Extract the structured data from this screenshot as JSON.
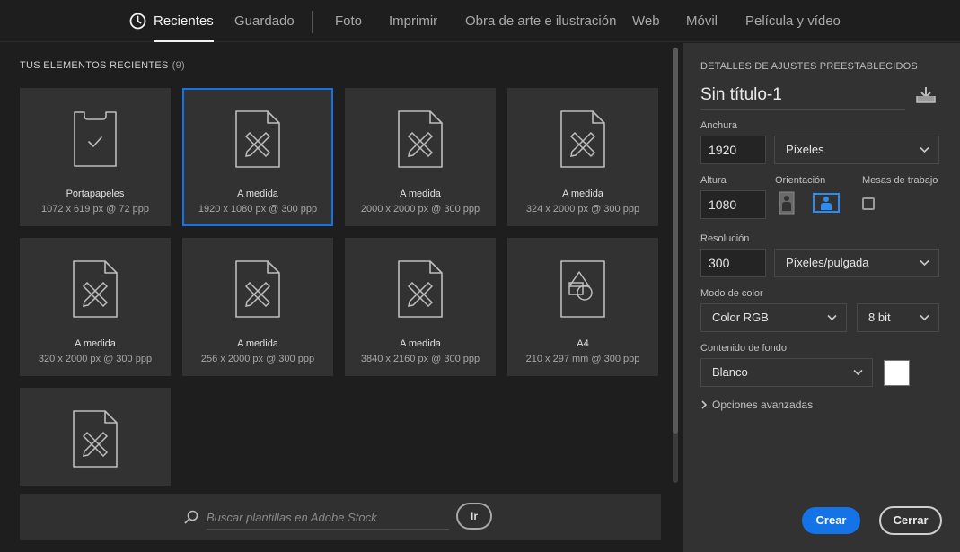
{
  "tabs": [
    {
      "label": "Recientes",
      "active": true,
      "icon": "clock-icon"
    },
    {
      "label": "Guardado"
    },
    {
      "label": "Foto"
    },
    {
      "label": "Imprimir"
    },
    {
      "label": "Obra de arte e ilustración"
    },
    {
      "label": "Web"
    },
    {
      "label": "Móvil"
    },
    {
      "label": "Película y vídeo"
    }
  ],
  "recent": {
    "title": "TUS ELEMENTOS RECIENTES",
    "count": "(9)",
    "items": [
      {
        "name": "Portapapeles",
        "dims": "1072 x 619 px @ 72 ppp",
        "icon": "clipboard-icon"
      },
      {
        "name": "A medida",
        "dims": "1920 x 1080 px @ 300 ppp",
        "icon": "custom-document-icon",
        "selected": true
      },
      {
        "name": "A medida",
        "dims": "2000 x 2000 px @ 300 ppp",
        "icon": "custom-document-icon"
      },
      {
        "name": "A medida",
        "dims": "324 x 2000 px @ 300 ppp",
        "icon": "custom-document-icon"
      },
      {
        "name": "A medida",
        "dims": "320 x 2000 px @ 300 ppp",
        "icon": "custom-document-icon"
      },
      {
        "name": "A medida",
        "dims": "256 x 2000 px @ 300 ppp",
        "icon": "custom-document-icon"
      },
      {
        "name": "A medida",
        "dims": "3840 x 2160 px @ 300 ppp",
        "icon": "custom-document-icon"
      },
      {
        "name": "A4",
        "dims": "210 x 297 mm @ 300 ppp",
        "icon": "shapes-document-icon"
      },
      {
        "name": "",
        "dims": "",
        "icon": "custom-document-icon"
      }
    ]
  },
  "search": {
    "placeholder": "Buscar plantillas en Adobe Stock",
    "value": "",
    "go_label": "Ir"
  },
  "preset": {
    "title": "DETALLES DE AJUSTES PREESTABLECIDOS",
    "doc_name": "Sin título-1",
    "width_label": "Anchura",
    "width_value": "1920",
    "width_unit": "Píxeles",
    "height_label": "Altura",
    "height_value": "1080",
    "orientation_label": "Orientación",
    "orientation_selected": "landscape",
    "artboards_label": "Mesas de trabajo",
    "artboards_checked": false,
    "resolution_label": "Resolución",
    "resolution_value": "300",
    "resolution_unit": "Píxeles/pulgada",
    "color_mode_label": "Modo de color",
    "color_mode_value": "Color RGB",
    "bit_depth_value": "8 bit",
    "background_label": "Contenido de fondo",
    "background_value": "Blanco",
    "background_color": "#ffffff",
    "advanced_label": "Opciones avanzadas"
  },
  "actions": {
    "create_label": "Crear",
    "close_label": "Cerrar"
  },
  "colors": {
    "accent": "#1473e6",
    "panel": "#323232",
    "background": "#1e1e1e"
  }
}
